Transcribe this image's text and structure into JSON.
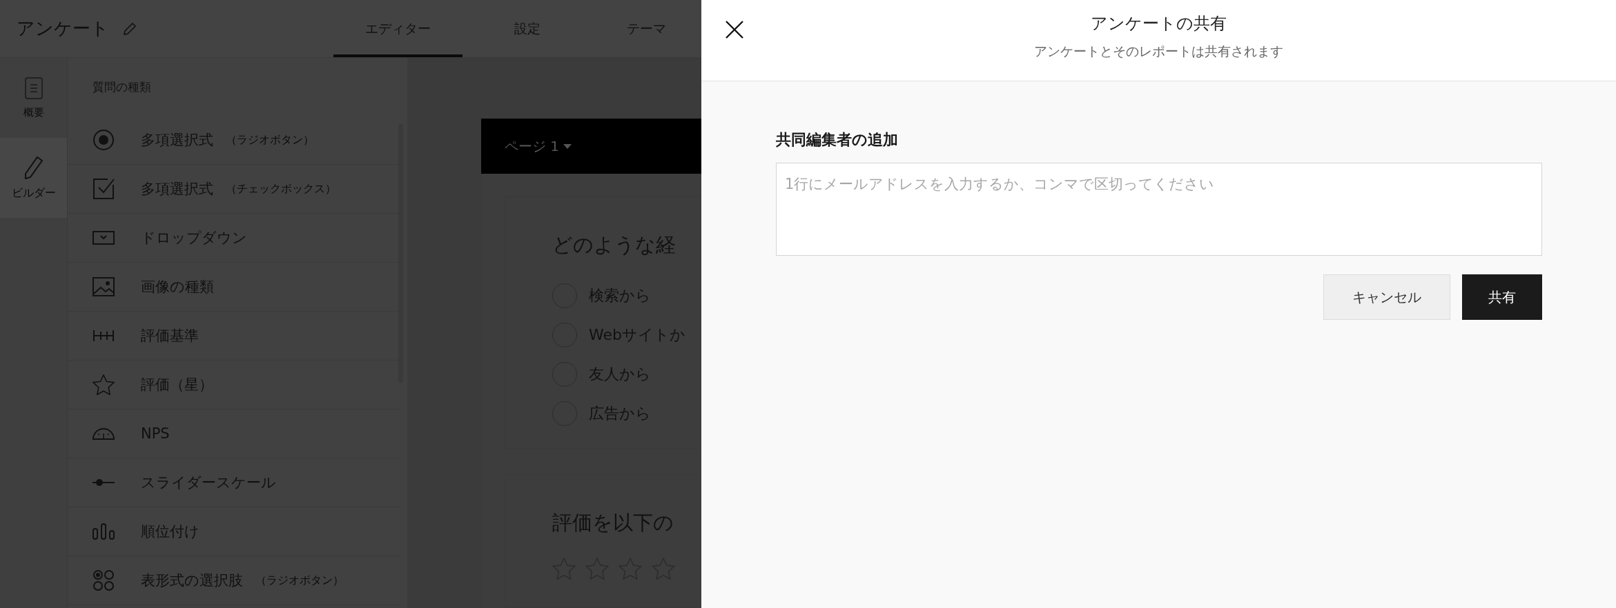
{
  "app_header": {
    "title": "アンケート",
    "tabs": [
      {
        "label": "エディター",
        "selected": true
      },
      {
        "label": "設定",
        "selected": false
      },
      {
        "label": "テーマ",
        "selected": false
      }
    ]
  },
  "rail": [
    {
      "kind": "document",
      "label": "概要",
      "selected": false
    },
    {
      "kind": "pencil",
      "label": "ビルダー",
      "selected": true
    }
  ],
  "question_types": {
    "heading": "質問の種類",
    "items": [
      {
        "kind": "radio",
        "label": "多項選択式",
        "note": "（ラジオボタン）"
      },
      {
        "kind": "checkbox",
        "label": "多項選択式",
        "note": "（チェックボックス）"
      },
      {
        "kind": "dropdown",
        "label": "ドロップダウン"
      },
      {
        "kind": "image",
        "label": "画像の種類"
      },
      {
        "kind": "scale",
        "label": "評価基準"
      },
      {
        "kind": "star",
        "label": "評価（星）"
      },
      {
        "kind": "nps",
        "label": "NPS"
      },
      {
        "kind": "slider",
        "label": "スライダースケール"
      },
      {
        "kind": "ranking",
        "label": "順位付け"
      },
      {
        "kind": "matrix",
        "label": "表形式の選択肢",
        "note": "（ラジオボタン）"
      }
    ]
  },
  "survey": {
    "page_label": "ページ 1",
    "questions": [
      {
        "kind": "choice",
        "text": "どのような経",
        "options": [
          {
            "label": "検索から",
            "selected": false
          },
          {
            "label": "Webサイトか",
            "selected": false
          },
          {
            "label": "友人から",
            "selected": false
          },
          {
            "label": "広告から",
            "selected": false
          }
        ]
      },
      {
        "kind": "rating",
        "text": "評価を以下の"
      }
    ]
  },
  "share_dialog": {
    "title": "アンケートの共有",
    "subtitle": "アンケートとそのレポートは共有されます",
    "field_label": "共同編集者の追加",
    "placeholder": "1行にメールアドレスを入力するか、コンマで区切ってください",
    "buttons": [
      {
        "kind": "secondary",
        "label": "キャンセル"
      },
      {
        "kind": "primary",
        "label": "共有"
      }
    ]
  }
}
